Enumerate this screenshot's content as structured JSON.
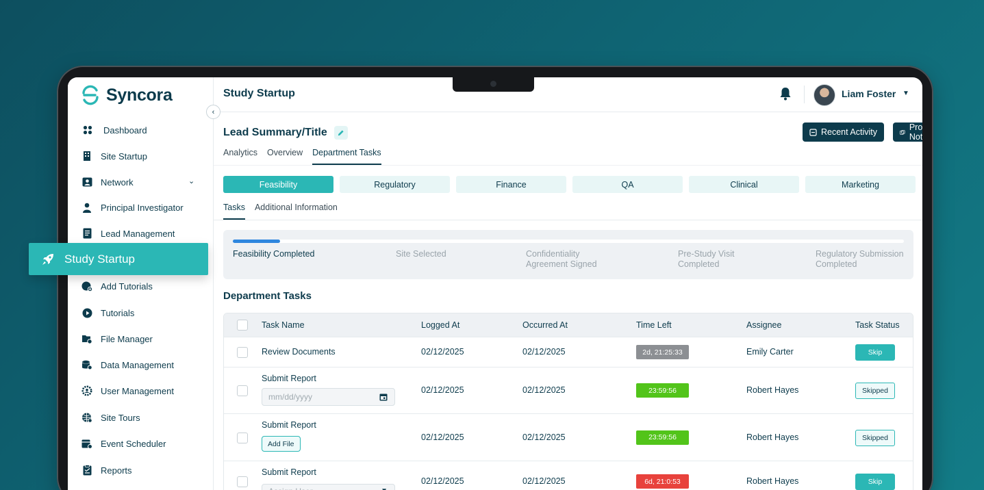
{
  "brand": {
    "name": "Syncora",
    "accent": "#2bb7b5",
    "dark": "#0d3b4c"
  },
  "sidebar": {
    "items": [
      {
        "label": "Dashboard",
        "icon": "dashboard-icon"
      },
      {
        "label": "Site Startup",
        "icon": "building-icon"
      },
      {
        "label": "Network",
        "icon": "network-icon",
        "has_submenu": true
      },
      {
        "label": "Principal Investigator",
        "icon": "person-icon"
      },
      {
        "label": "Lead Management",
        "icon": "document-icon"
      },
      {
        "label": "Add Tutorials",
        "icon": "add-tutorial-icon"
      },
      {
        "label": "Tutorials",
        "icon": "play-icon"
      },
      {
        "label": "File Manager",
        "icon": "file-manager-icon"
      },
      {
        "label": "Data Management",
        "icon": "data-icon"
      },
      {
        "label": "User Management",
        "icon": "user-gear-icon"
      },
      {
        "label": "Site Tours",
        "icon": "globe-icon"
      },
      {
        "label": "Event Scheduler",
        "icon": "calendar-icon"
      },
      {
        "label": "Reports",
        "icon": "report-icon"
      }
    ],
    "active_item": {
      "label": "Study Startup",
      "icon": "rocket-icon"
    }
  },
  "header": {
    "title": "Study Startup",
    "user_name": "Liam Foster"
  },
  "lead": {
    "title": "Lead Summary/Title",
    "recent_activity_label": "Recent Activity",
    "progress_notes_label": "Progress Notes"
  },
  "main_tabs": [
    {
      "label": "Analytics",
      "active": false
    },
    {
      "label": "Overview",
      "active": false
    },
    {
      "label": "Department Tasks",
      "active": true
    }
  ],
  "department_tabs": [
    {
      "label": "Feasibility",
      "active": true
    },
    {
      "label": "Regulatory",
      "active": false
    },
    {
      "label": "Finance",
      "active": false
    },
    {
      "label": "QA",
      "active": false
    },
    {
      "label": "Clinical",
      "active": false
    },
    {
      "label": "Marketing",
      "active": false
    }
  ],
  "sub_tabs": [
    {
      "label": "Tasks",
      "active": true
    },
    {
      "label": "Additional Information",
      "active": false
    }
  ],
  "progress": {
    "fraction_complete": 0.07,
    "steps": [
      {
        "line1": "Feasibility Completed",
        "line2": "",
        "done": true
      },
      {
        "line1": "Site Selected",
        "line2": "",
        "done": false
      },
      {
        "line1": "Confidentiality",
        "line2": "Agreement Signed",
        "done": false
      },
      {
        "line1": "Pre-Study Visit",
        "line2": "Completed",
        "done": false
      },
      {
        "line1": "Regulatory Submission",
        "line2": "Completed",
        "done": false
      }
    ]
  },
  "tasks": {
    "section_title": "Department Tasks",
    "columns": [
      "Task Name",
      "Logged At",
      "Occurred At",
      "Time Left",
      "Assignee",
      "Task Status"
    ],
    "rows": [
      {
        "name": "Review Documents",
        "logged": "02/12/2025",
        "occurred": "02/12/2025",
        "time_left": "2d, 21:25:33",
        "time_color": "gray",
        "assignee": "Emily Carter",
        "status": "Skip"
      },
      {
        "name": "Submit Report",
        "logged": "02/12/2025",
        "occurred": "02/12/2025",
        "time_left": "23:59:56",
        "time_color": "green",
        "assignee": "Robert Hayes",
        "status": "Skipped",
        "extra": {
          "type": "date",
          "placeholder": "mm/dd/yyyy"
        }
      },
      {
        "name": "Submit Report",
        "logged": "02/12/2025",
        "occurred": "02/12/2025",
        "time_left": "23:59:56",
        "time_color": "green",
        "assignee": "Robert Hayes",
        "status": "Skipped",
        "extra": {
          "type": "file",
          "label": "Add File"
        }
      },
      {
        "name": "Submit Report",
        "logged": "02/12/2025",
        "occurred": "02/12/2025",
        "time_left": "6d, 21:0:53",
        "time_color": "red",
        "assignee": "Robert Hayes",
        "status": "Skip",
        "extra": {
          "type": "select",
          "placeholder": "Assign User"
        }
      }
    ]
  }
}
